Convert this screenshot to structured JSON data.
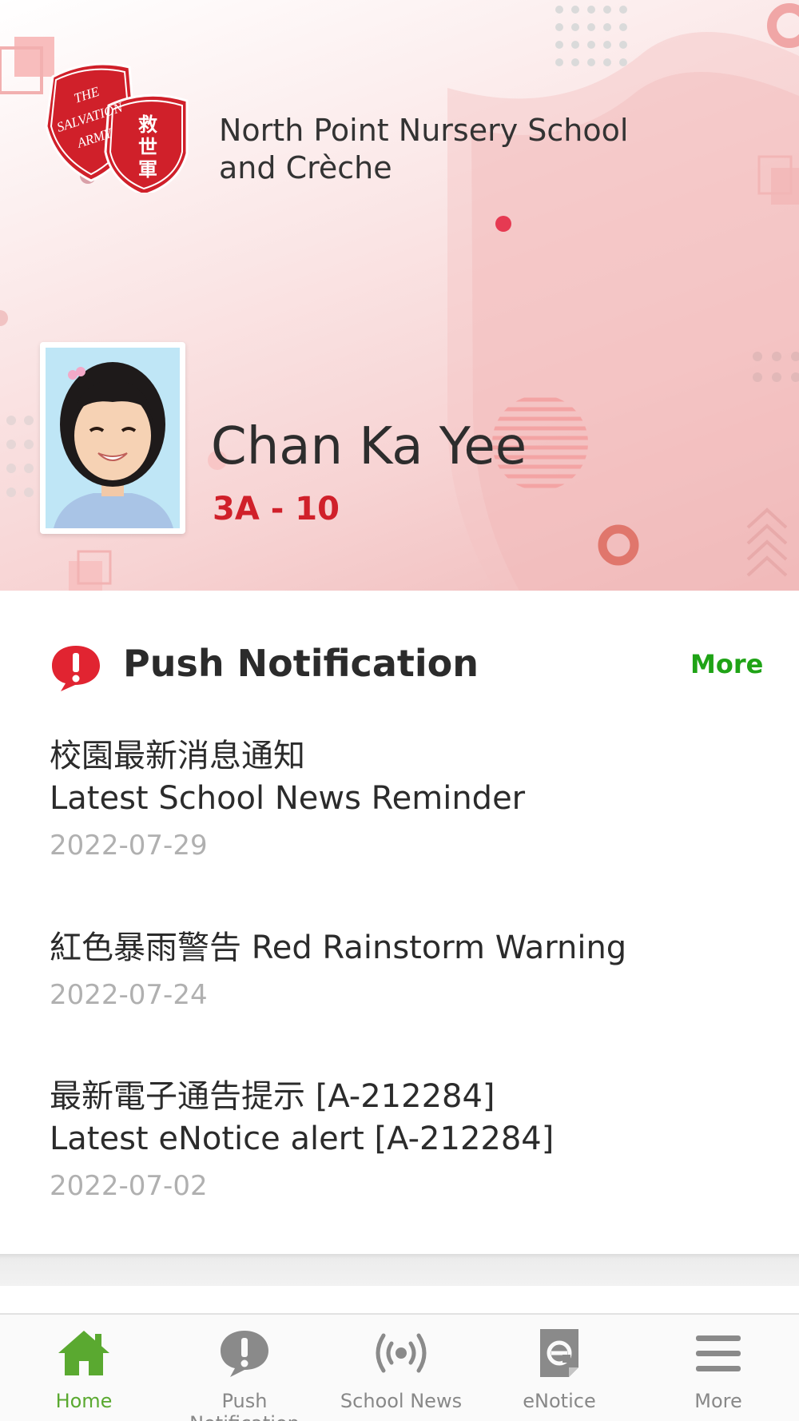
{
  "school": {
    "logo_text_en": "THE SALVATION ARMY",
    "logo_text_zh": "救世軍",
    "name_line1": "North Point Nursery School",
    "name_line2": "and Crèche"
  },
  "student": {
    "name": "Chan Ka Yee",
    "class": "3A - 10"
  },
  "push_section": {
    "title": "Push Notification",
    "more_label": "More",
    "items": [
      {
        "title": "校園最新消息通知\nLatest School News Reminder",
        "date": "2022-07-29"
      },
      {
        "title": "紅色暴雨警告 Red Rainstorm Warning",
        "date": "2022-07-24"
      },
      {
        "title": "最新電子通告提示 [A-212284]\nLatest eNotice alert [A-212284]",
        "date": "2022-07-02"
      }
    ]
  },
  "bottom_nav": {
    "items": [
      {
        "label": "Home",
        "icon": "home-icon",
        "active": true
      },
      {
        "label": "Push Notification",
        "icon": "push-notification-icon",
        "active": false
      },
      {
        "label": "School News",
        "icon": "broadcast-icon",
        "active": false
      },
      {
        "label": "eNotice",
        "icon": "enotice-icon",
        "active": false
      },
      {
        "label": "More",
        "icon": "menu-icon",
        "active": false
      }
    ]
  },
  "colors": {
    "accent_red": "#d0202a",
    "active_green": "#5aa930",
    "more_green": "#1fa316",
    "date_gray": "#b0b0b0"
  }
}
